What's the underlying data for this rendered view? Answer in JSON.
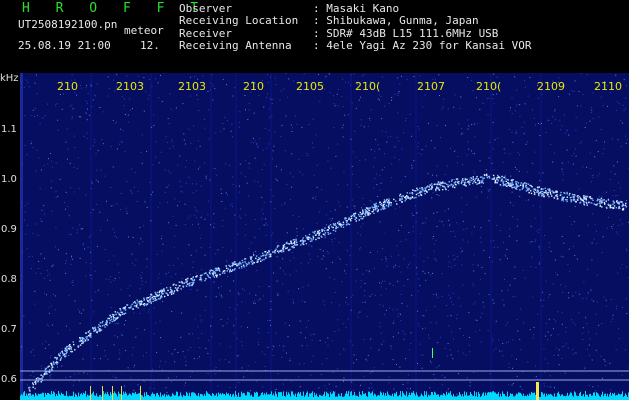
{
  "header": {
    "brand": "H R O F F T",
    "filename": "UT2508192100.pn",
    "filename_suffix": "meteor",
    "datetime": "25.08.19 21:00",
    "counter": "12.",
    "info": [
      {
        "label": "Observer",
        "value": ": Masaki Kano"
      },
      {
        "label": "Receiving Location",
        "value": ": Shibukawa, Gunma, Japan"
      },
      {
        "label": "Receiver",
        "value": ": SDR# 43dB L15 111.6MHz USB"
      },
      {
        "label": "Receiving Antenna",
        "value": ": 4ele Yagi Az 230 for Kansai VOR"
      }
    ]
  },
  "spectrogram": {
    "unit_label": "kHz",
    "y_ticks": [
      "1.1",
      "1.0",
      "0.9",
      "0.8",
      "0.7",
      "0.6"
    ],
    "x_ticks": [
      "210",
      "2103",
      "2103",
      "210",
      "2105",
      "210(",
      "2107",
      "210(",
      "2109",
      "2110"
    ],
    "background_color": "#060e62",
    "trace_color": "#7ab8ff",
    "baseline_color": "#00d8ff",
    "tick_color": "#e8e800"
  }
}
